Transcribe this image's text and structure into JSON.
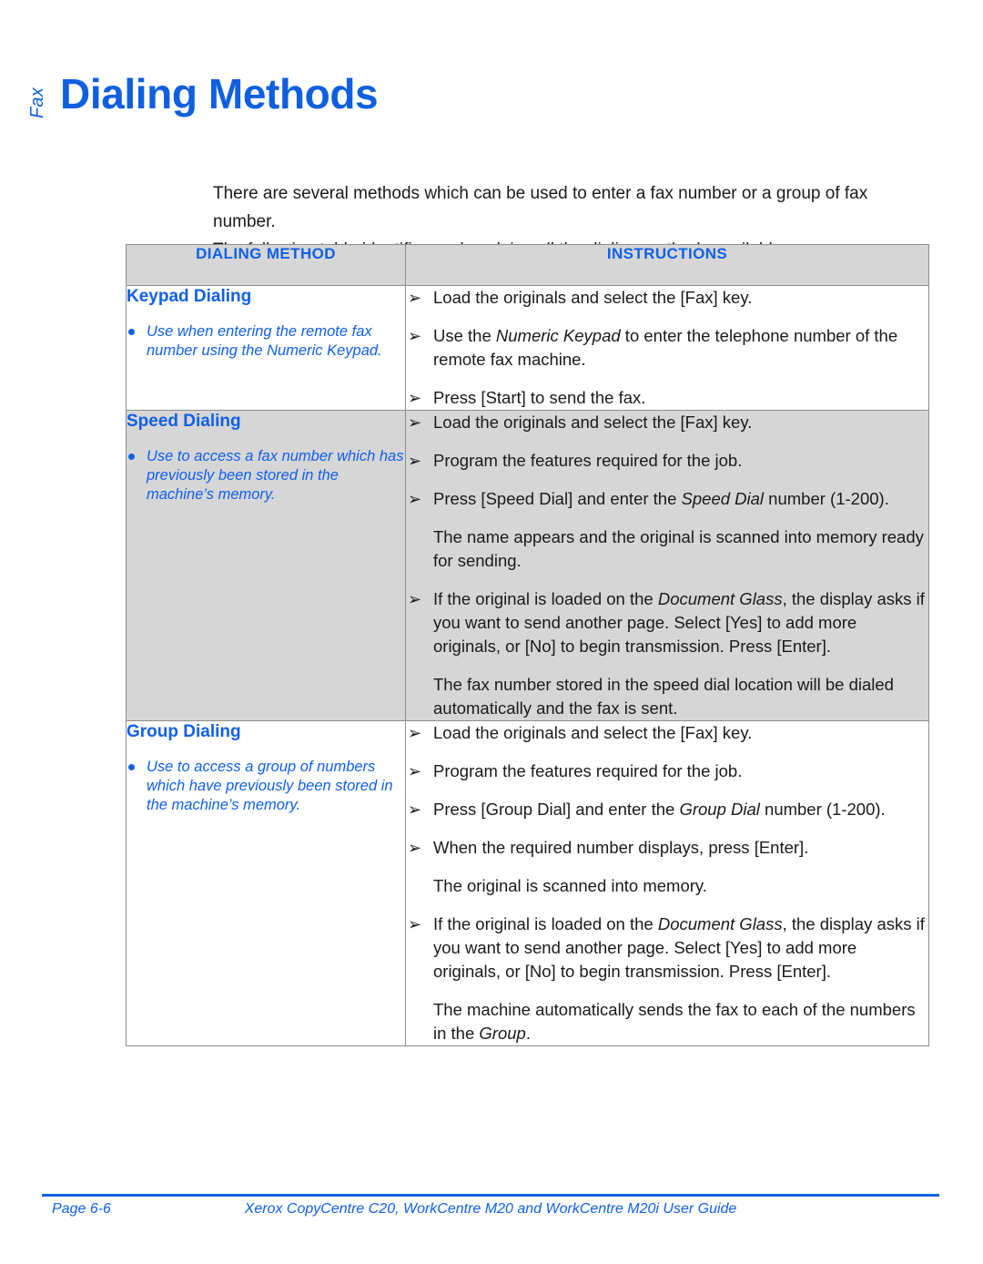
{
  "header": {
    "chapter_tab": "Fax",
    "title": "Dialing Methods"
  },
  "intro": {
    "line1": "There are several methods which can be used to enter a fax number or a group of fax number.",
    "line2": "The following table identifies and explains all the dialing methods available."
  },
  "table": {
    "columns": [
      {
        "label": "DIALING METHOD"
      },
      {
        "label": "INSTRUCTIONS"
      }
    ],
    "rows": [
      {
        "method_title": "Keypad Dialing",
        "method_bullet": "Use when entering the remote fax number using the Numeric Keypad.",
        "instructions": [
          {
            "type": "arrow",
            "pre": "Load the originals and select the [Fax] key.",
            "em": "",
            "post": ""
          },
          {
            "type": "arrow",
            "pre": "Use the ",
            "em": "Numeric Keypad",
            "post": " to enter the telephone number of the remote fax machine."
          },
          {
            "type": "arrow",
            "pre": "Press [Start] to send the fax.",
            "em": "",
            "post": ""
          }
        ]
      },
      {
        "method_title": "Speed Dialing",
        "method_bullet": "Use to access a fax number which has previously been stored in the machine’s memory.",
        "instructions": [
          {
            "type": "arrow",
            "pre": "Load the originals and select the [Fax] key.",
            "em": "",
            "post": ""
          },
          {
            "type": "arrow",
            "pre": "Program the features required for the job.",
            "em": "",
            "post": ""
          },
          {
            "type": "arrow",
            "pre": "Press [Speed Dial] and enter the ",
            "em": "Speed Dial",
            "post": " number (1-200)."
          },
          {
            "type": "note",
            "pre": "The name appears and the original is scanned into memory ready for sending.",
            "em": "",
            "post": ""
          },
          {
            "type": "arrow",
            "pre": "If the original is loaded on the ",
            "em": "Document Glass",
            "post": ", the display asks if you want to send another page. Select [Yes] to add more originals, or [No] to begin transmission. Press [Enter]."
          },
          {
            "type": "note",
            "pre": "The fax number stored in the speed dial location will be dialed automatically and the fax is sent.",
            "em": "",
            "post": ""
          }
        ]
      },
      {
        "method_title": "Group Dialing",
        "method_bullet": "Use to access a group of numbers which have previously been stored in the machine’s memory.",
        "instructions": [
          {
            "type": "arrow",
            "pre": "Load the originals and select the [Fax] key.",
            "em": "",
            "post": ""
          },
          {
            "type": "arrow",
            "pre": "Program the features required for the job.",
            "em": "",
            "post": ""
          },
          {
            "type": "arrow",
            "pre": "Press [Group Dial] and enter the ",
            "em": "Group Dial",
            "post": " number (1-200)."
          },
          {
            "type": "arrow",
            "pre": "When the required number displays, press [Enter].",
            "em": "",
            "post": ""
          },
          {
            "type": "note",
            "pre": "The original is scanned into memory.",
            "em": "",
            "post": ""
          },
          {
            "type": "arrow",
            "pre": "If the original is loaded on the ",
            "em": "Document Glass",
            "post": ", the display asks if you want to send another page. Select [Yes] to add more originals, or [No] to begin transmission. Press [Enter]."
          },
          {
            "type": "note",
            "pre": "The machine automatically sends the fax to each of the numbers in the ",
            "em": "Group",
            "post": "."
          }
        ]
      }
    ],
    "arrow_glyph": "➢"
  },
  "footer": {
    "page_label": "Page 6-6",
    "guide_title": "Xerox CopyCentre C20, WorkCentre M20 and WorkCentre M20i User Guide"
  },
  "colors": {
    "accent_blue": "#1060e8",
    "header_gray": "#d6d6d6",
    "border_gray": "#8e8e8e"
  }
}
